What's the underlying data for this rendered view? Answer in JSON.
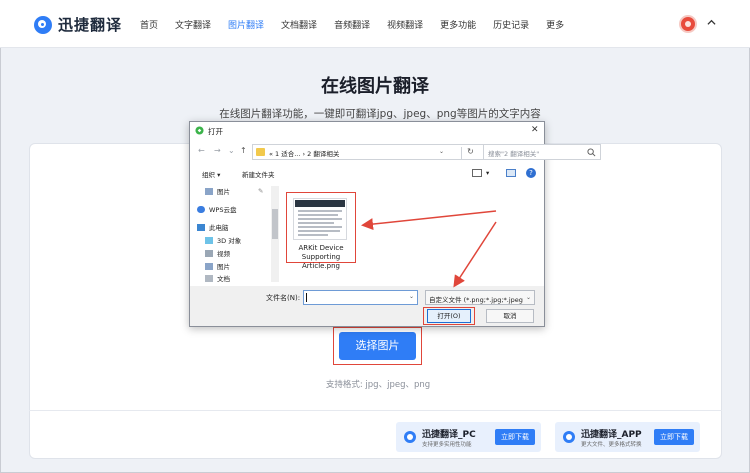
{
  "app": {
    "logo_text": "迅捷翻译",
    "nav": [
      "首页",
      "文字翻译",
      "图片翻译",
      "文档翻译",
      "音频翻译",
      "视频翻译",
      "更多功能",
      "历史记录",
      "更多"
    ],
    "active_nav": "图片翻译"
  },
  "hero": {
    "title": "在线图片翻译",
    "subtitle": "在线图片翻译功能，一键即可翻译jpg、jpeg、png等图片的文字内容"
  },
  "upload": {
    "select_button": "选择图片",
    "formats": "支持格式: jpg、jpeg、png"
  },
  "downloads": [
    {
      "title": "迅捷翻译_PC",
      "sub": "支持更多实用性功能",
      "button": "立即下载"
    },
    {
      "title": "迅捷翻译_APP",
      "sub": "更大文件、更多格式转换",
      "button": "立即下载"
    }
  ],
  "dialog": {
    "title": "打开",
    "breadcrumb": "« 1 适合...  ›  2 翻译相关",
    "search_placeholder": "搜索\"2 翻译相关\"",
    "organize": "组织 ▾",
    "new_folder": "新建文件夹",
    "nav_items": [
      "图片",
      "WPS云盘",
      "此电脑",
      "3D 对象",
      "视频",
      "图片",
      "文档"
    ],
    "file": {
      "name": "ARKit Device Supporting Article.png"
    },
    "filename_label": "文件名(N):",
    "filename_value": "",
    "filetype": "自定义文件 (*.png;*.jpg;*.jpeg",
    "open_button": "打开(O)",
    "cancel_button": "取消"
  },
  "colors": {
    "accent": "#2f7df6",
    "highlight": "#e0463a"
  }
}
